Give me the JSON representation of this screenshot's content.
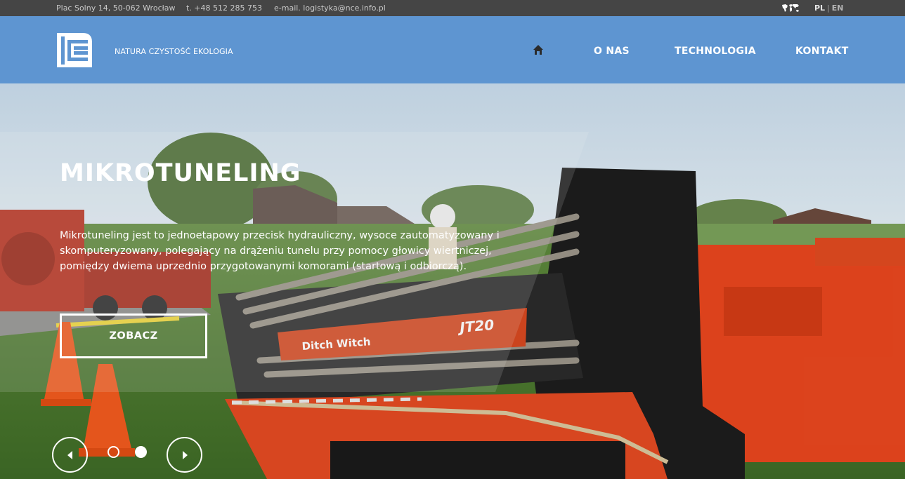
{
  "topbar": {
    "address": "Plac Solny 14, 50-062 Wrocław",
    "phone": "t. +48 512 285 753",
    "email": "e-mail. logistyka@nce.info.pl",
    "lang_pl": "PL",
    "lang_sep": "|",
    "lang_en": "EN",
    "globe_icon": "world-map-icon"
  },
  "header": {
    "logo_icon": "nce-logo",
    "tagline": "NATURA CZYSTOŚĆ EKOLOGIA",
    "nav": {
      "home_icon": "home-icon",
      "onas": "O NAS",
      "technologia": "TECHNOLOGIA",
      "kontakt": "KONTAKT"
    }
  },
  "hero": {
    "title": "MIKROTUNELING",
    "description": "Mikrotuneling jest to jednoetapowy przecisk hydrauliczny, wysoce zautomatyzowany i skomputeryzowany, polegający na drążeniu tunelu przy pomocy głowicy wiertniczej, pomiędzy dwiema uprzednio przygotowanymi komorami (startową i odbiorczą).",
    "button": "ZOBACZ",
    "slides": {
      "count": 2,
      "active": 2
    }
  },
  "colors": {
    "topbar_bg": "#454545",
    "header_bg": "#5e95d1",
    "machine_orange": "#e8461e",
    "text_white": "#ffffff"
  }
}
